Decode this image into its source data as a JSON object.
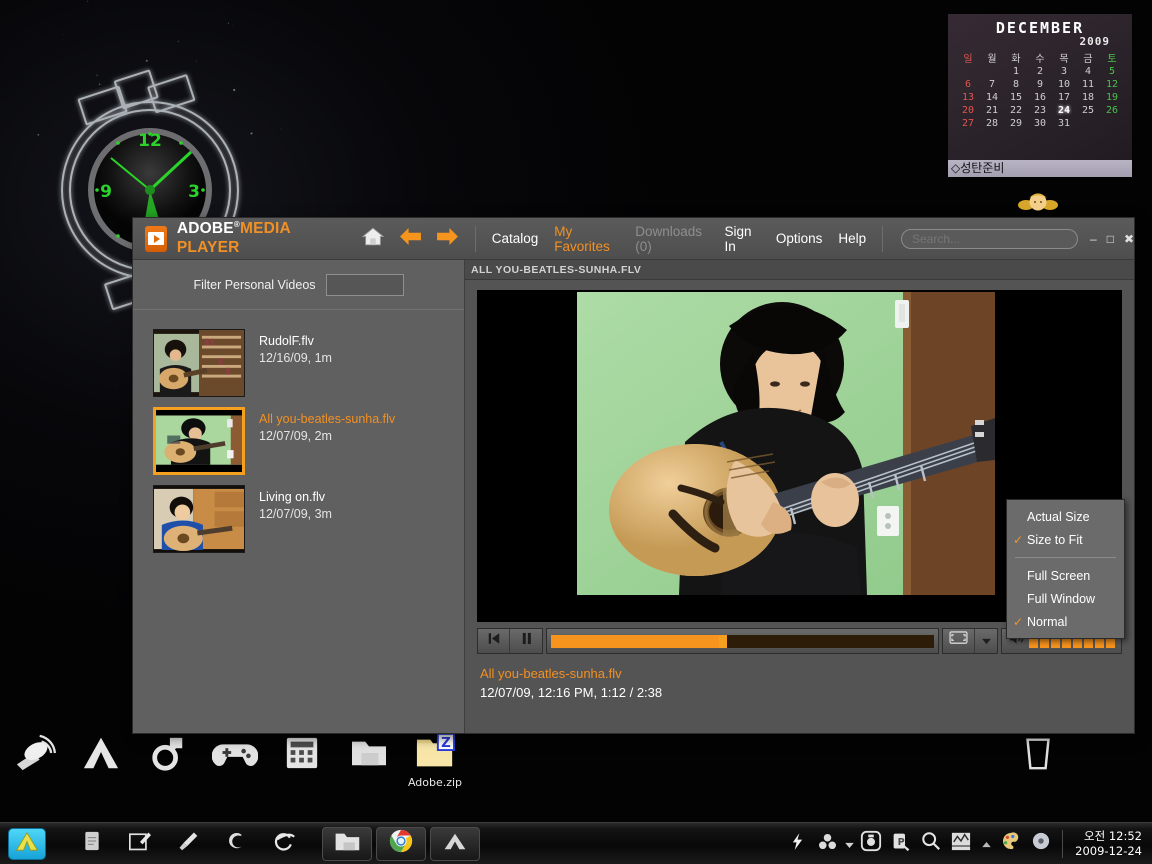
{
  "desktop": {
    "icons": [
      {
        "name": "satellite-dish-icon",
        "label": ""
      },
      {
        "name": "adobe-icon",
        "label": ""
      },
      {
        "name": "spiral-arrow-icon",
        "label": ""
      },
      {
        "name": "gamepad-icon",
        "label": ""
      },
      {
        "name": "calculator-icon",
        "label": ""
      },
      {
        "name": "folder-icon",
        "label": ""
      },
      {
        "name": "zip-archive-icon",
        "label": "Adobe.zip"
      },
      {
        "name": "trash-bin-icon",
        "label": ""
      }
    ],
    "memo_text": "◇성탄준비"
  },
  "clock_widget": {
    "numerals": [
      "12",
      "3",
      "9"
    ],
    "hand_color": "#2ad52a"
  },
  "calendar": {
    "month": "DECEMBER",
    "year": "2009",
    "day_headers": [
      "일",
      "월",
      "화",
      "수",
      "목",
      "금",
      "토"
    ],
    "weeks": [
      [
        "",
        "",
        "1",
        "2",
        "3",
        "4",
        "5"
      ],
      [
        "6",
        "7",
        "8",
        "9",
        "10",
        "11",
        "12"
      ],
      [
        "13",
        "14",
        "15",
        "16",
        "17",
        "18",
        "19"
      ],
      [
        "20",
        "21",
        "22",
        "23",
        "24",
        "25",
        "26"
      ],
      [
        "27",
        "28",
        "29",
        "30",
        "31",
        "",
        ""
      ]
    ],
    "today": "24",
    "sunday_color": "#e2564f",
    "saturday_color": "#4ac24a"
  },
  "player": {
    "brand": {
      "word1": "ADOBE",
      "registered": "®",
      "word2": "MEDIA PLAYER"
    },
    "nav": {
      "home_icon": "home-icon",
      "back_icon": "back-arrow-icon",
      "forward_icon": "forward-arrow-icon"
    },
    "menu": [
      {
        "label": "Catalog",
        "style": "normal"
      },
      {
        "label": "My Favorites",
        "style": "active"
      },
      {
        "label": "Downloads (0)",
        "style": "dim"
      },
      {
        "label": "Sign In",
        "style": "normal"
      },
      {
        "label": "Options",
        "style": "normal"
      },
      {
        "label": "Help",
        "style": "normal"
      }
    ],
    "search": {
      "placeholder": "Search...",
      "value": ""
    },
    "window_controls": {
      "minimize": "–",
      "maximize": "□",
      "close": "✖"
    },
    "sidebar": {
      "filter_label": "Filter Personal Videos",
      "filter_value": "",
      "items": [
        {
          "title": "RudolF.flv",
          "sub": "12/16/09, 1m",
          "selected": false
        },
        {
          "title": "All you-beatles-sunha.flv",
          "sub": "12/07/09, 2m",
          "selected": true
        },
        {
          "title": "Living on.flv",
          "sub": "12/07/09, 3m",
          "selected": false
        }
      ]
    },
    "main": {
      "header_title": "ALL YOU-BEATLES-SUNHA.FLV",
      "now_playing_title": "All you-beatles-sunha.flv",
      "now_playing_sub": "12/07/09, 12:16 PM,  1:12 / 2:38",
      "controls": {
        "prev_icon": "skip-previous-icon",
        "pause_icon": "pause-icon",
        "screen_icon": "screen-size-icon",
        "dropdown_icon": "chevron-down-icon",
        "volume_icon": "speaker-icon",
        "volume_blocks": 8,
        "progress_percent": 45,
        "elapsed": "1:12",
        "duration": "2:38"
      }
    },
    "context_menu": [
      {
        "label": "Actual Size",
        "checked": false
      },
      {
        "label": "Size to Fit",
        "checked": true
      },
      {
        "separator": true
      },
      {
        "label": "Full Screen",
        "checked": false
      },
      {
        "label": "Full Window",
        "checked": false
      },
      {
        "label": "Normal",
        "checked": true
      }
    ]
  },
  "taskbar": {
    "start_icon": "start-button-icon",
    "quick_launch": [
      {
        "name": "notes-icon"
      },
      {
        "name": "pencil-edit-icon"
      },
      {
        "name": "brush-clean-icon"
      },
      {
        "name": "spiral-icon"
      },
      {
        "name": "internet-explorer-icon"
      }
    ],
    "tasks": [
      {
        "name": "taskbar-explorer-window"
      },
      {
        "name": "taskbar-chrome-window"
      },
      {
        "name": "taskbar-adobe-media-player-window"
      }
    ],
    "tray": [
      {
        "name": "power-lightning-icon"
      },
      {
        "name": "cluster-dots-icon"
      },
      {
        "name": "tray-overflow-chevron-icon"
      },
      {
        "name": "capture-tool-icon"
      },
      {
        "name": "pen-tool-icon"
      },
      {
        "name": "search-icon"
      },
      {
        "name": "monitor-graph-icon"
      },
      {
        "name": "tray-expand-icon"
      },
      {
        "name": "palette-icon"
      },
      {
        "name": "disc-icon"
      }
    ],
    "clock": {
      "time": "오전 12:52",
      "date": "2009-12-24"
    }
  },
  "colors": {
    "accent_orange": "#f19024",
    "selection_orange": "#f5a01f",
    "window_gray": "#545454",
    "sidebar_gray": "#606060"
  }
}
